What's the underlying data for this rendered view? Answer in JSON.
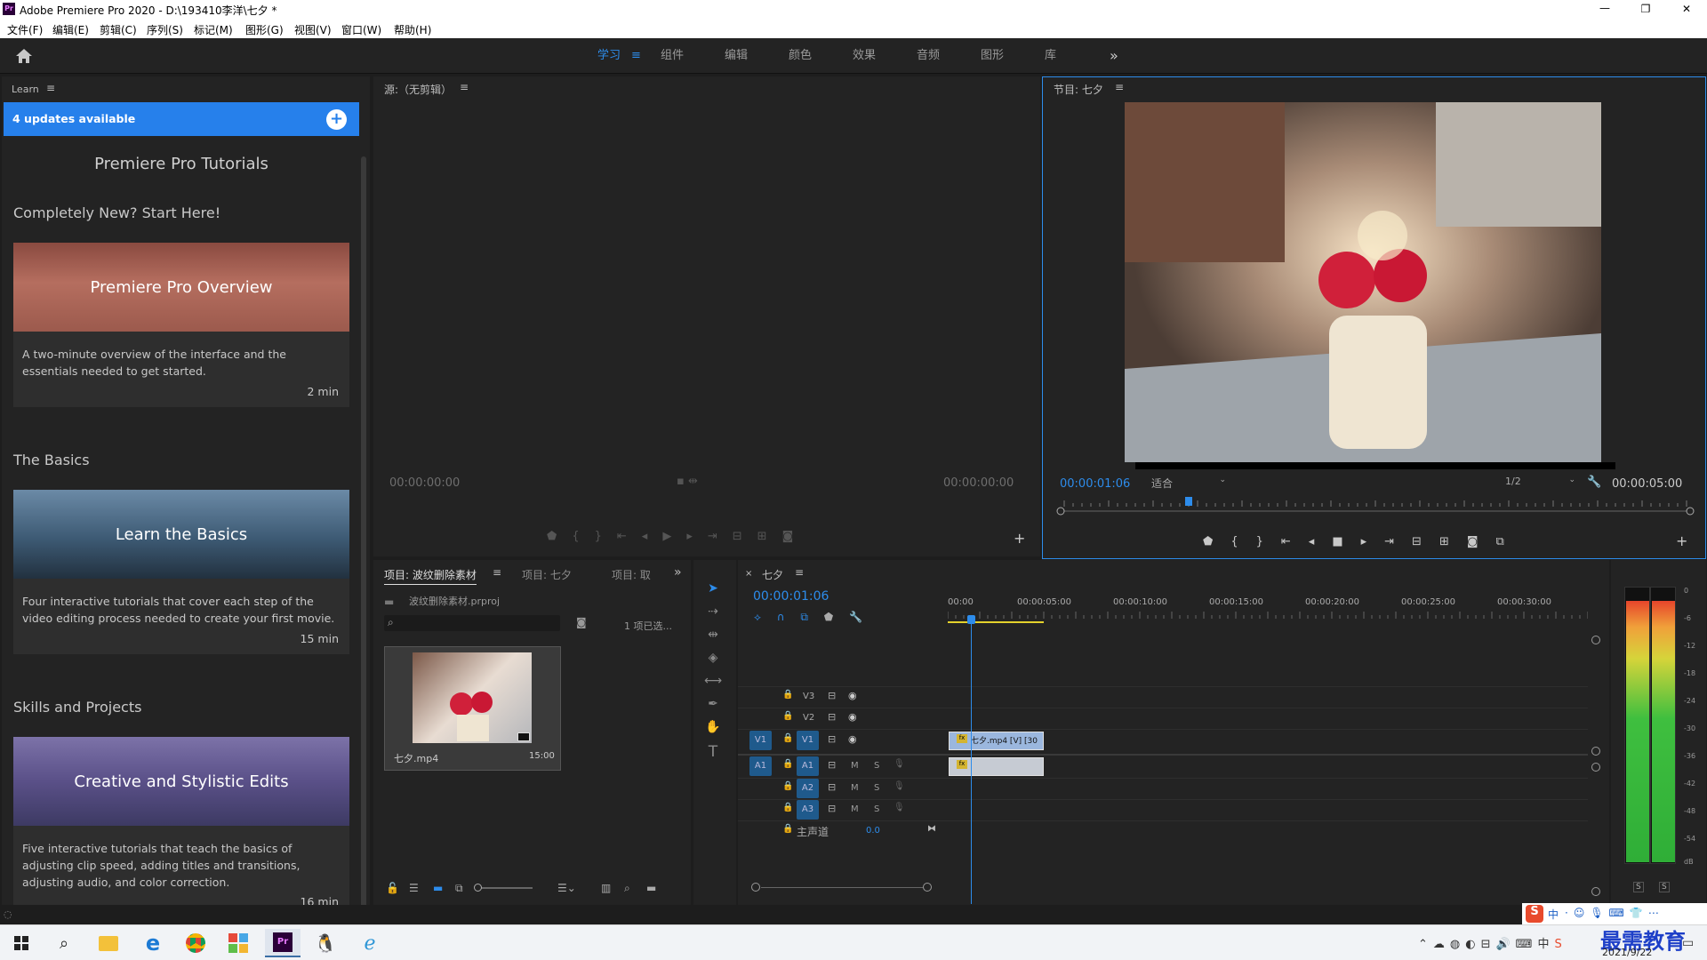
{
  "window": {
    "app_icon": "Pr",
    "title": "Adobe Premiere Pro 2020 - D:\\193410李洋\\七夕 *"
  },
  "menu": [
    "文件(F)",
    "编辑(E)",
    "剪辑(C)",
    "序列(S)",
    "标记(M)",
    "图形(G)",
    "视图(V)",
    "窗口(W)",
    "帮助(H)"
  ],
  "workspaces": {
    "active": "学习",
    "items": [
      "组件",
      "编辑",
      "颜色",
      "效果",
      "音频",
      "图形",
      "库"
    ],
    "more": "»"
  },
  "learn": {
    "panel_title": "Learn",
    "updates": "4 updates available",
    "tutorials_title": "Premiere Pro Tutorials",
    "sections": [
      {
        "heading": "Completely New? Start Here!",
        "card_title": "Premiere Pro Overview",
        "description": "A two-minute overview of the interface and the essentials needed to get started.",
        "duration": "2 min"
      },
      {
        "heading": "The Basics",
        "card_title": "Learn the Basics",
        "description": "Four interactive tutorials that cover each step of the video editing process needed to create your first movie.",
        "duration": "15 min"
      },
      {
        "heading": "Skills and Projects",
        "card_title": "Creative and Stylistic Edits",
        "description": "Five interactive tutorials that teach the basics of adjusting clip speed, adding titles and transitions, adjusting audio, and color correction.",
        "duration": "16 min"
      }
    ]
  },
  "source": {
    "title": "源:（无剪辑）",
    "tc_left": "00:00:00:00",
    "tc_right": "00:00:00:00"
  },
  "program": {
    "title": "节目: 七夕",
    "timecode": "00:00:01:06",
    "fit": "适合",
    "resolution": "1/2",
    "duration": "00:00:05:00",
    "playhead_fraction": 0.24
  },
  "project": {
    "tabs": [
      "项目: 波纹删除素材",
      "项目: 七夕",
      "项目: 取"
    ],
    "file": "波纹删除素材.prproj",
    "selected": "1 项已选...",
    "clip": {
      "name": "七夕.mp4",
      "duration": "15:00"
    }
  },
  "timeline": {
    "tab": "七夕",
    "timecode": "00:00:01:06",
    "ruler": [
      "00:00",
      "00:00:05:00",
      "00:00:10:00",
      "00:00:15:00",
      "00:00:20:00",
      "00:00:25:00",
      "00:00:30:00"
    ],
    "video_tracks": [
      "V3",
      "V2",
      "V1"
    ],
    "audio_tracks": [
      "A1",
      "A2",
      "A3"
    ],
    "source_v": "V1",
    "source_a": "A1",
    "master": "主声道",
    "master_value": "0.0",
    "video_clip": "七夕.mp4 [V] [30",
    "ms": {
      "m": "M",
      "s": "S"
    }
  },
  "meter": {
    "scale": [
      "0",
      "-6",
      "-12",
      "-18",
      "-24",
      "-30",
      "-36",
      "-42",
      "-48",
      "-54",
      "dB"
    ],
    "solo": [
      "S",
      "S"
    ],
    "level_fraction": 0.95
  },
  "ime": {
    "lang": "中",
    "brand": "最需教育"
  },
  "taskbar": {
    "date": "2021/9/22",
    "ime_lang": "中"
  },
  "colors": {
    "accent": "#2d8ceb",
    "panel": "#232323",
    "bg": "#1d1d1d"
  }
}
